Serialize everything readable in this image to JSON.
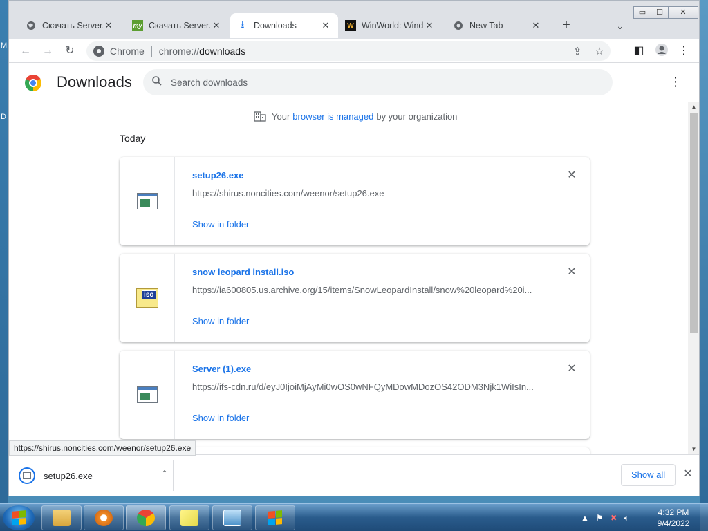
{
  "desktop": {
    "left_letters": [
      "M",
      "D"
    ]
  },
  "window": {
    "controls": {
      "minimize": "▭",
      "maximize": "☐",
      "close": "✕"
    }
  },
  "tabs": [
    {
      "title": "Скачать Server.e",
      "icon": "globe-icon",
      "active": false
    },
    {
      "title": "Скачать Server.e",
      "icon": "my-icon",
      "icon_text": "my",
      "active": false
    },
    {
      "title": "Downloads",
      "icon": "download-icon",
      "active": true
    },
    {
      "title": "WinWorld: Wind",
      "icon": "winworld-icon",
      "icon_text": "W",
      "active": false
    },
    {
      "title": "New Tab",
      "icon": "chrome-icon",
      "active": false
    }
  ],
  "toolbar": {
    "back": "←",
    "forward": "→",
    "reload": "↻",
    "omnibox_label": "Chrome",
    "url_scheme": "chrome://",
    "url_host": "downloads",
    "share": "⇪",
    "bookmark": "☆",
    "side_panel": "◧",
    "profile": "●",
    "menu": "⋮"
  },
  "page": {
    "title": "Downloads",
    "search_placeholder": "Search downloads",
    "more": "⋮",
    "managed": {
      "prefix": "Your",
      "link": "browser is managed",
      "suffix": "by your organization"
    },
    "section": "Today"
  },
  "downloads": [
    {
      "name": "setup26.exe",
      "url": "https://shirus.noncities.com/weenor/setup26.exe",
      "action": "Show in folder",
      "icon": "exe-file-icon"
    },
    {
      "name": "snow leopard install.iso",
      "url": "https://ia600805.us.archive.org/15/items/SnowLeopardInstall/snow%20leopard%20i...",
      "action": "Show in folder",
      "icon": "iso-file-icon",
      "icon_text": "iso"
    },
    {
      "name": "Server (1).exe",
      "url": "https://ifs-cdn.ru/d/eyJ0IjoiMjAyMi0wOS0wNFQyMDowMDozOS42ODM3Njk1WiIsIn...",
      "action": "Show in folder",
      "icon": "exe-file-icon"
    }
  ],
  "remove_glyph": "✕",
  "status_url": "https://shirus.noncities.com/weenor/setup26.exe",
  "shelf": {
    "file": "setup26.exe",
    "caret": "⌃",
    "show_all": "Show all",
    "close": "✕"
  },
  "taskbar": {
    "apps": [
      "explorer",
      "media-player",
      "chrome",
      "sticky-notes",
      "remote-desktop",
      "windows-update"
    ],
    "time": "4:32 PM",
    "date": "9/4/2022"
  },
  "colors": {
    "accent": "#1a73e8",
    "text_secondary": "#5f6368"
  }
}
